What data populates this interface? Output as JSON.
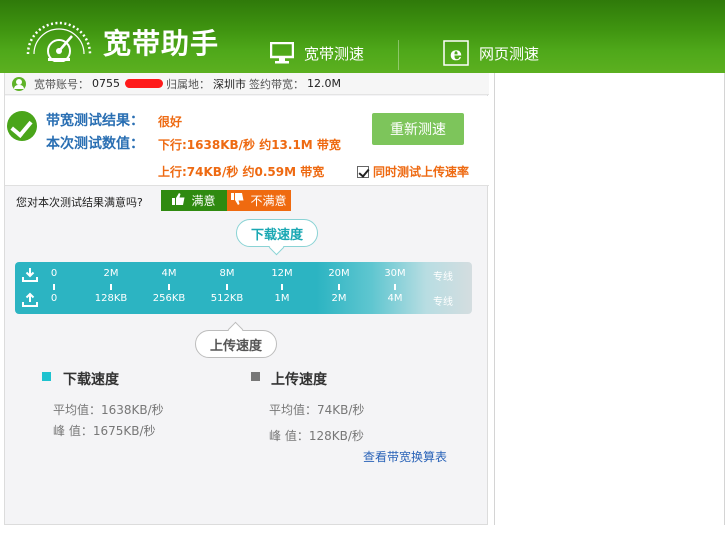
{
  "app": {
    "title": "宽带助手",
    "colors": {
      "header_green": "#3f9410",
      "accent_blue": "#2a6fb3",
      "accent_orange": "#ee6a12",
      "bar_teal": "#2cb4c2"
    }
  },
  "nav": {
    "broadband_label": "宽带测速",
    "broadband_icon": "monitor-icon",
    "web_label": "网页测速",
    "web_icon": "ie-browser-icon"
  },
  "account": {
    "label": "宽带账号：",
    "number_prefix": "0755",
    "location_label": "归属地：",
    "location_value": "深圳市",
    "bandwidth_label": "签约带宽：",
    "bandwidth_value": "12.0M"
  },
  "result": {
    "label_result": "带宽测试结果：",
    "label_values": "本次测试数值：",
    "rating": "很好",
    "download": "下行:1638KB/秒 约13.1M 带宽",
    "upload": "上行:74KB/秒 约0.59M 带宽",
    "retest_label": "重新测速",
    "sync_upload_label": "同时测试上传速率",
    "sync_upload_checked": true
  },
  "feedback": {
    "question": "您对本次测试结果满意吗?",
    "satisfied_label": "满意",
    "unsatisfied_label": "不满意"
  },
  "gauge": {
    "download_bubble": "下载速度",
    "upload_bubble": "上传速度",
    "download_ticks": [
      "0",
      "2M",
      "4M",
      "8M",
      "12M",
      "20M",
      "30M",
      "专线"
    ],
    "upload_ticks": [
      "0",
      "128KB",
      "256KB",
      "512KB",
      "1M",
      "2M",
      "4M",
      "专线"
    ]
  },
  "stats": {
    "download_title": "下载速度",
    "upload_title": "上传速度",
    "download_avg": "平均值：1638KB/秒",
    "download_peak": "峰  值：1675KB/秒",
    "upload_avg": "平均值：74KB/秒",
    "upload_peak": "峰  值：128KB/秒",
    "conversion_link": "查看带宽换算表"
  }
}
